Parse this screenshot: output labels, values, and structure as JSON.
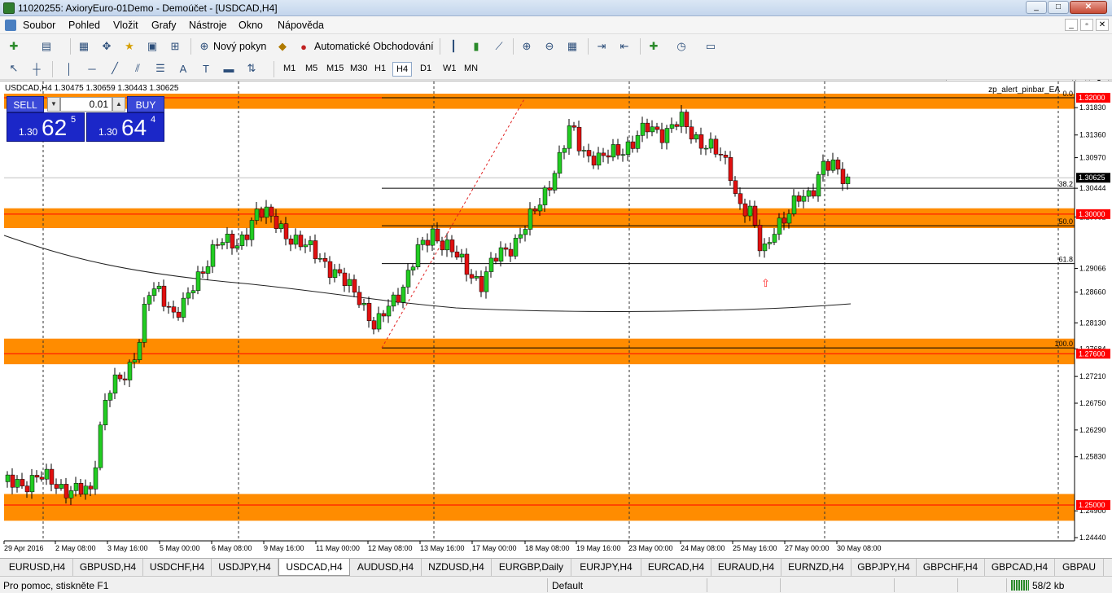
{
  "window": {
    "title": "11020255: AxioryEuro-01Demo - Demoúčet - [USDCAD,H4]"
  },
  "menu": [
    "Soubor",
    "Pohled",
    "Vložit",
    "Grafy",
    "Nástroje",
    "Okno",
    "Nápověda"
  ],
  "toolbar": {
    "new_order_label": "Nový pokyn",
    "autotrading_label": "Automatické Obchodování"
  },
  "timeframes": [
    "M1",
    "M5",
    "M15",
    "M30",
    "H1",
    "H4",
    "D1",
    "W1",
    "MN"
  ],
  "active_timeframe": "H4",
  "chart": {
    "info": "USDCAD,H4  1.30475 1.30659 1.30443 1.30625",
    "ea_label": "zp_alert_pinbar_EA",
    "one_click": {
      "sell_label": "SELL",
      "buy_label": "BUY",
      "lot": "0.01",
      "sell_small": "1.30",
      "sell_big": "62",
      "sell_sup": "5",
      "buy_small": "1.30",
      "buy_big": "64",
      "buy_sup": "4"
    },
    "current_price": "1.30625",
    "levels": [
      "1.32000",
      "1.30000",
      "1.27600",
      "1.25000"
    ],
    "fib_labels": [
      "0.0",
      "38.2",
      "50.0",
      "61.8",
      "100.0"
    ],
    "y_ticks": [
      "1.31830",
      "1.31360",
      "1.30970",
      "1.30444",
      "1.29952",
      "1.29066",
      "1.28660",
      "1.28130",
      "1.27684",
      "1.27210",
      "1.26750",
      "1.26290",
      "1.25830",
      "1.24900",
      "1.24440"
    ],
    "x_ticks": [
      "29 Apr 2016",
      "2 May 08:00",
      "3 May 16:00",
      "5 May 00:00",
      "6 May 08:00",
      "9 May 16:00",
      "11 May 00:00",
      "12 May 08:00",
      "13 May 16:00",
      "17 May 00:00",
      "18 May 08:00",
      "19 May 16:00",
      "23 May 00:00",
      "24 May 08:00",
      "25 May 16:00",
      "27 May 00:00",
      "30 May 08:00"
    ],
    "colors": {
      "bull": "#22cc22",
      "bear": "#e01010",
      "zone": "#ff8c00",
      "level": "#ff0000"
    }
  },
  "tabs": [
    "EURUSD,H4",
    "GBPUSD,H4",
    "USDCHF,H4",
    "USDJPY,H4",
    "USDCAD,H4",
    "AUDUSD,H4",
    "NZDUSD,H4",
    "EURGBP,Daily",
    "EURJPY,H4",
    "EURCAD,H4",
    "EURAUD,H4",
    "EURNZD,H4",
    "GBPJPY,H4",
    "GBPCHF,H4",
    "GBPCAD,H4",
    "GBPAU"
  ],
  "active_tab": "USDCAD,H4",
  "status": {
    "help": "Pro pomoc, stiskněte F1",
    "profile": "Default",
    "connection": "58/2 kb"
  }
}
